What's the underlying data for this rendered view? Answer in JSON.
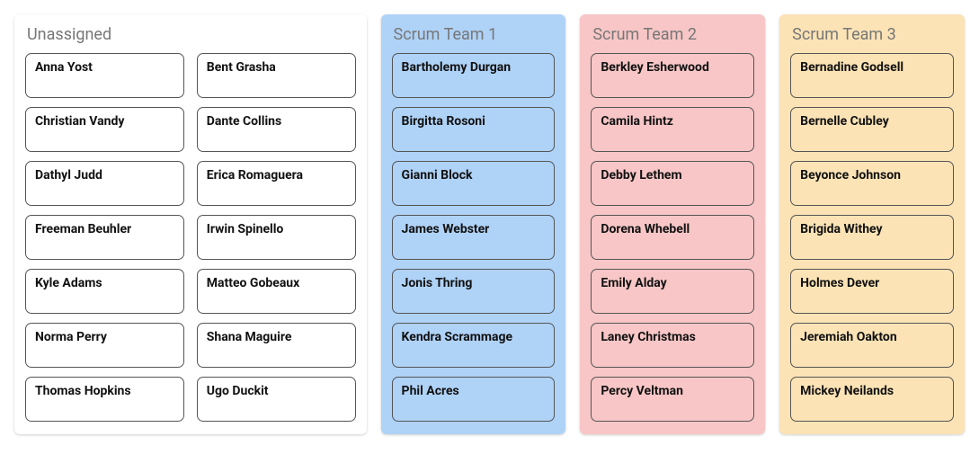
{
  "columns": [
    {
      "id": "unassigned",
      "title": "Unassigned",
      "layout": "2col",
      "theme": "unassigned",
      "cards": [
        "Anna Yost",
        "Bent Grasha",
        "Christian Vandy",
        "Dante Collins",
        "Dathyl Judd",
        "Erica Romaguera",
        "Freeman Beuhler",
        "Irwin Spinello",
        "Kyle Adams",
        "Matteo Gobeaux",
        "Norma Perry",
        "Shana Maguire",
        "Thomas Hopkins",
        "Ugo Duckit"
      ]
    },
    {
      "id": "team1",
      "title": "Scrum Team 1",
      "layout": "1col",
      "theme": "team1",
      "cards": [
        "Bartholemy Durgan",
        "Birgitta Rosoni",
        "Gianni Block",
        "James Webster",
        "Jonis Thring",
        "Kendra Scrammage",
        "Phil Acres"
      ]
    },
    {
      "id": "team2",
      "title": "Scrum Team 2",
      "layout": "1col",
      "theme": "team2",
      "cards": [
        "Berkley Esherwood",
        "Camila Hintz",
        "Debby Lethem",
        "Dorena Whebell",
        "Emily Alday",
        "Laney Christmas",
        "Percy Veltman"
      ]
    },
    {
      "id": "team3",
      "title": "Scrum Team 3",
      "layout": "1col",
      "theme": "team3",
      "cards": [
        "Bernadine Godsell",
        "Bernelle Cubley",
        "Beyonce Johnson",
        "Brigida Withey",
        "Holmes Dever",
        "Jeremiah Oakton",
        "Mickey Neilands"
      ]
    }
  ]
}
